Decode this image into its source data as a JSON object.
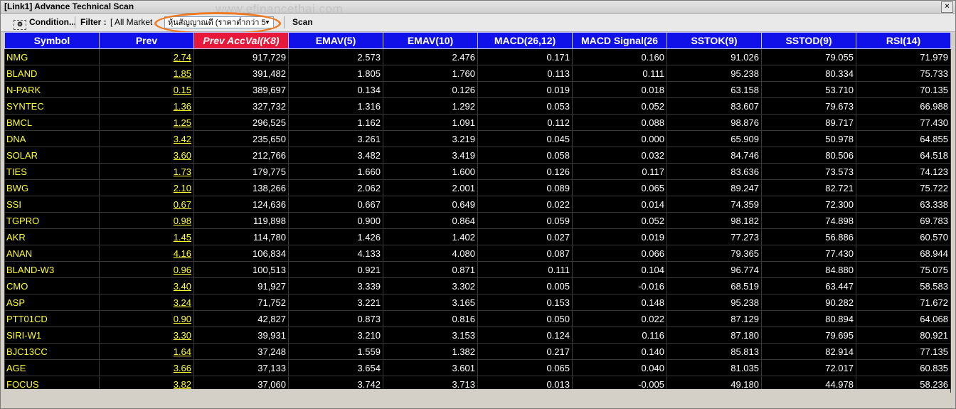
{
  "window": {
    "title": "[Link1] Advance Technical Scan",
    "watermark": "www.efinancethai.com",
    "close_glyph": "×"
  },
  "toolbar": {
    "condition_label": "Condition...",
    "filter_label": "Filter :",
    "market_value": "[ All Market",
    "preset_value": "หุ้นสัญญาณดี (ราคาต่ำกว่า 5",
    "scan_label": "Scan"
  },
  "columns": [
    "Symbol",
    "Prev",
    "Prev AccVal(K8)",
    "EMAV(5)",
    "EMAV(10)",
    "MACD(26,12)",
    "MACD Signal(26",
    "SSTOK(9)",
    "SSTOD(9)",
    "RSI(14)"
  ],
  "rows": [
    [
      "NMG",
      "2.74",
      "917,729",
      "2.573",
      "2.476",
      "0.171",
      "0.160",
      "91.026",
      "79.055",
      "71.979"
    ],
    [
      "BLAND",
      "1.85",
      "391,482",
      "1.805",
      "1.760",
      "0.113",
      "0.111",
      "95.238",
      "80.334",
      "75.733"
    ],
    [
      "N-PARK",
      "0.15",
      "389,697",
      "0.134",
      "0.126",
      "0.019",
      "0.018",
      "63.158",
      "53.710",
      "70.135"
    ],
    [
      "SYNTEC",
      "1.36",
      "327,732",
      "1.316",
      "1.292",
      "0.053",
      "0.052",
      "83.607",
      "79.673",
      "66.988"
    ],
    [
      "BMCL",
      "1.25",
      "296,525",
      "1.162",
      "1.091",
      "0.112",
      "0.088",
      "98.876",
      "89.717",
      "77.430"
    ],
    [
      "DNA",
      "3.42",
      "235,650",
      "3.261",
      "3.219",
      "0.045",
      "0.000",
      "65.909",
      "50.978",
      "64.855"
    ],
    [
      "SOLAR",
      "3.60",
      "212,766",
      "3.482",
      "3.419",
      "0.058",
      "0.032",
      "84.746",
      "80.506",
      "64.518"
    ],
    [
      "TIES",
      "1.73",
      "179,775",
      "1.660",
      "1.600",
      "0.126",
      "0.117",
      "83.636",
      "73.573",
      "74.123"
    ],
    [
      "BWG",
      "2.10",
      "138,266",
      "2.062",
      "2.001",
      "0.089",
      "0.065",
      "89.247",
      "82.721",
      "75.722"
    ],
    [
      "SSI",
      "0.67",
      "124,636",
      "0.667",
      "0.649",
      "0.022",
      "0.014",
      "74.359",
      "72.300",
      "63.338"
    ],
    [
      "TGPRO",
      "0.98",
      "119,898",
      "0.900",
      "0.864",
      "0.059",
      "0.052",
      "98.182",
      "74.898",
      "69.783"
    ],
    [
      "AKR",
      "1.45",
      "114,780",
      "1.426",
      "1.402",
      "0.027",
      "0.019",
      "77.273",
      "56.886",
      "60.570"
    ],
    [
      "ANAN",
      "4.16",
      "106,834",
      "4.133",
      "4.080",
      "0.087",
      "0.066",
      "79.365",
      "77.430",
      "68.944"
    ],
    [
      "BLAND-W3",
      "0.96",
      "100,513",
      "0.921",
      "0.871",
      "0.111",
      "0.104",
      "96.774",
      "84.880",
      "75.075"
    ],
    [
      "CMO",
      "3.40",
      "91,927",
      "3.339",
      "3.302",
      "0.005",
      "-0.016",
      "68.519",
      "63.447",
      "58.583"
    ],
    [
      "ASP",
      "3.24",
      "71,752",
      "3.221",
      "3.165",
      "0.153",
      "0.148",
      "95.238",
      "90.282",
      "71.672"
    ],
    [
      "PTT01CD",
      "0.90",
      "42,827",
      "0.873",
      "0.816",
      "0.050",
      "0.022",
      "87.129",
      "80.894",
      "64.068"
    ],
    [
      "SIRI-W1",
      "3.30",
      "39,931",
      "3.210",
      "3.153",
      "0.124",
      "0.116",
      "87.180",
      "79.695",
      "80.921"
    ],
    [
      "BJC13CC",
      "1.64",
      "37,248",
      "1.559",
      "1.382",
      "0.217",
      "0.140",
      "85.813",
      "82.914",
      "77.135"
    ],
    [
      "AGE",
      "3.66",
      "37,133",
      "3.654",
      "3.601",
      "0.065",
      "0.040",
      "81.035",
      "72.017",
      "60.835"
    ],
    [
      "FOCUS",
      "3.82",
      "37,060",
      "3.742",
      "3.713",
      "0.013",
      "-0.005",
      "49.180",
      "44.978",
      "58.236"
    ]
  ],
  "colors": {
    "header_bg": "#1010e8",
    "sorted_header_bg": "#e8183a",
    "symbol_text": "#ffff30",
    "grid_bg": "#000000",
    "highlight": "#f07a22"
  },
  "icons": {
    "condition": "condition-icon",
    "dropdown": "chevron-down-icon",
    "dropdown_glyph": "▼",
    "condition_glyph": "⚙"
  }
}
